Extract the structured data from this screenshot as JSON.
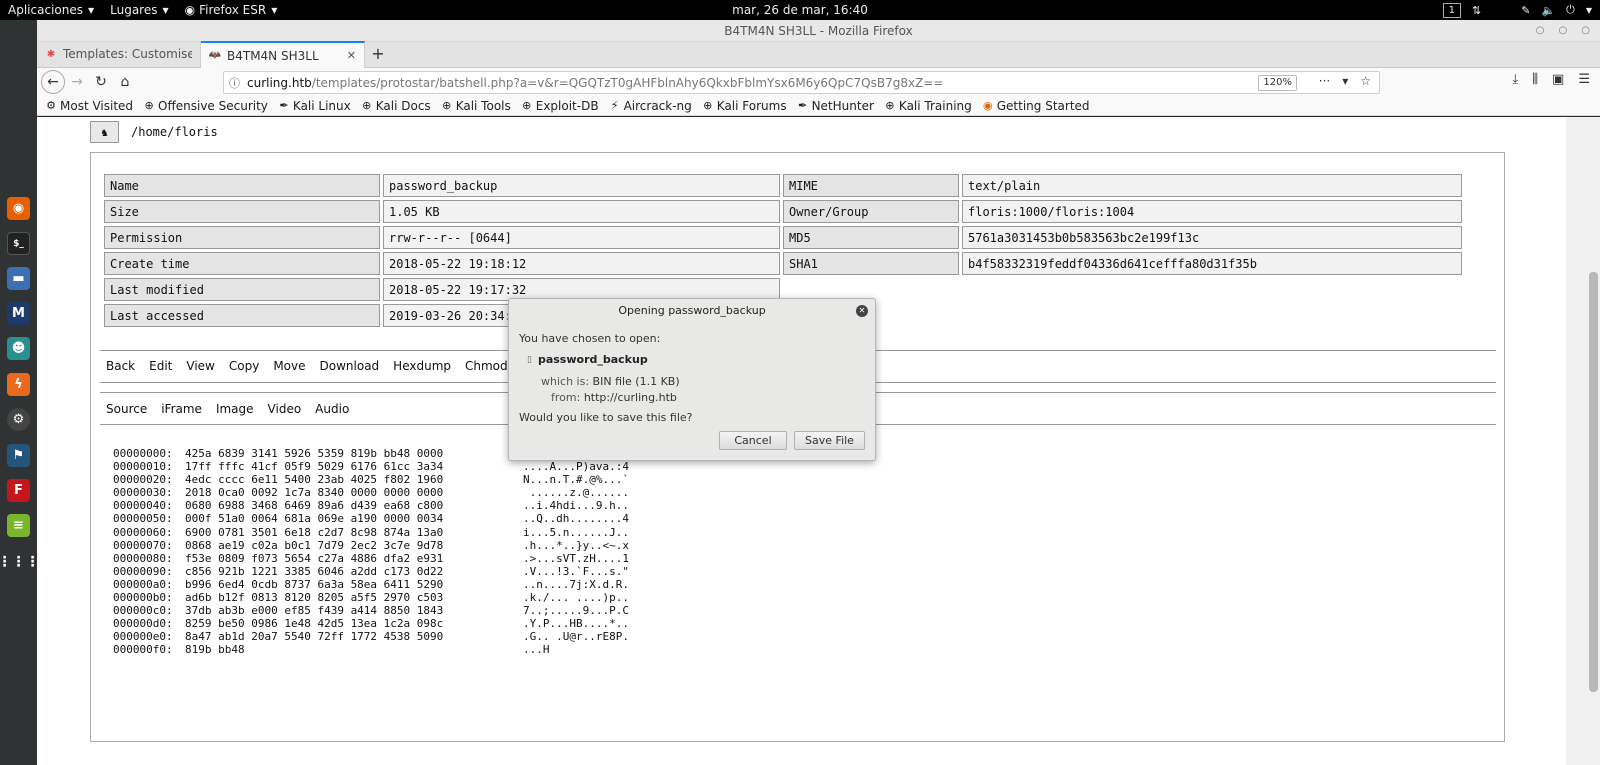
{
  "topbar": {
    "menus": [
      "Aplicaciones",
      "Lugares",
      "Firefox ESR"
    ],
    "clock": "mar, 26 de mar, 16:40",
    "workspace": "1"
  },
  "window": {
    "title": "B4TM4N SH3LL - Mozilla Firefox"
  },
  "tabs": [
    {
      "label": "Templates: Customise (P"
    },
    {
      "label": "B4TM4N SH3LL"
    }
  ],
  "navbar": {
    "url_host": "curling.htb",
    "url_path": "/templates/protostar/batshell.php?a=v&r=QGQTzT0gAHFblnAhy6QkxbFblmYsx6M6y6QpC7QsB7g8xZ==",
    "zoom": "120%"
  },
  "bookmarks": [
    "Most Visited",
    "Offensive Security",
    "Kali Linux",
    "Kali Docs",
    "Kali Tools",
    "Exploit-DB",
    "Aircrack-ng",
    "Kali Forums",
    "NetHunter",
    "Kali Training",
    "Getting Started"
  ],
  "page": {
    "current_path": "/home/floris",
    "info_rows": [
      [
        "Name",
        "password_backup",
        "MIME",
        "text/plain"
      ],
      [
        "Size",
        "1.05 KB",
        "Owner/Group",
        "floris:1000/floris:1004"
      ],
      [
        "Permission",
        "rrw-r--r-- [0644]",
        "MD5",
        "5761a3031453b0b583563bc2e199f13c"
      ],
      [
        "Create time",
        "2018-05-22 19:18:12",
        "SHA1",
        "b4f58332319feddf04336d641cefffa80d31f35b"
      ],
      [
        "Last modified",
        "2018-05-22 19:17:32",
        "",
        ""
      ],
      [
        "Last accessed",
        "2019-03-26 20:34:",
        "",
        ""
      ]
    ],
    "actions": [
      "Back",
      "Edit",
      "View",
      "Copy",
      "Move",
      "Download",
      "Hexdump",
      "Chmod",
      "Cho"
    ],
    "view_tabs": [
      "Source",
      "iFrame",
      "Image",
      "Video",
      "Audio"
    ],
    "hexdump": [
      {
        "addr": "00000000:",
        "hex": "425a 6839 3141 5926 5359 819b bb48 0000",
        "ascii": "BZh91AY&S"
      },
      {
        "addr": "00000010:",
        "hex": "17ff fffc 41cf 05f9 5029 6176 61cc 3a34",
        "ascii": "....A...P)ava.:4"
      },
      {
        "addr": "00000020:",
        "hex": "4edc cccc 6e11 5400 23ab 4025 f802 1960",
        "ascii": "N...n.T.#.@%...`"
      },
      {
        "addr": "00000030:",
        "hex": "2018 0ca0 0092 1c7a 8340 0000 0000 0000",
        "ascii": " ......z.@......"
      },
      {
        "addr": "00000040:",
        "hex": "0680 6988 3468 6469 89a6 d439 ea68 c800",
        "ascii": "..i.4hdi...9.h.."
      },
      {
        "addr": "00000050:",
        "hex": "000f 51a0 0064 681a 069e a190 0000 0034",
        "ascii": "..Q..dh........4"
      },
      {
        "addr": "00000060:",
        "hex": "6900 0781 3501 6e18 c2d7 8c98 874a 13a0",
        "ascii": "i...5.n......J.."
      },
      {
        "addr": "00000070:",
        "hex": "0868 ae19 c02a b0c1 7d79 2ec2 3c7e 9d78",
        "ascii": ".h...*..}y..<~.x"
      },
      {
        "addr": "00000080:",
        "hex": "f53e 0809 f073 5654 c27a 4886 dfa2 e931",
        "ascii": ".>...sVT.zH....1"
      },
      {
        "addr": "00000090:",
        "hex": "c856 921b 1221 3385 6046 a2dd c173 0d22",
        "ascii": ".V...!3.`F...s.\""
      },
      {
        "addr": "000000a0:",
        "hex": "b996 6ed4 0cdb 8737 6a3a 58ea 6411 5290",
        "ascii": "..n....7j:X.d.R."
      },
      {
        "addr": "000000b0:",
        "hex": "ad6b b12f 0813 8120 8205 a5f5 2970 c503",
        "ascii": ".k./... ....)p.."
      },
      {
        "addr": "000000c0:",
        "hex": "37db ab3b e000 ef85 f439 a414 8850 1843",
        "ascii": "7..;.....9...P.C"
      },
      {
        "addr": "000000d0:",
        "hex": "8259 be50 0986 1e48 42d5 13ea 1c2a 098c",
        "ascii": ".Y.P...HB....*.."
      },
      {
        "addr": "000000e0:",
        "hex": "8a47 ab1d 20a7 5540 72ff 1772 4538 5090",
        "ascii": ".G.. .U@r..rE8P."
      },
      {
        "addr": "000000f0:",
        "hex": "819b bb48",
        "ascii": "...H"
      }
    ]
  },
  "dialog": {
    "title": "Opening password_backup",
    "chosen_text": "You have chosen to open:",
    "filename": "password_backup",
    "which_is_label": "which is:",
    "which_is_value": "BIN file (1.1 KB)",
    "from_label": "from:",
    "from_value": "http://curling.htb",
    "question": "Would you like to save this file?",
    "cancel_label": "Cancel",
    "save_label": "Save File"
  }
}
